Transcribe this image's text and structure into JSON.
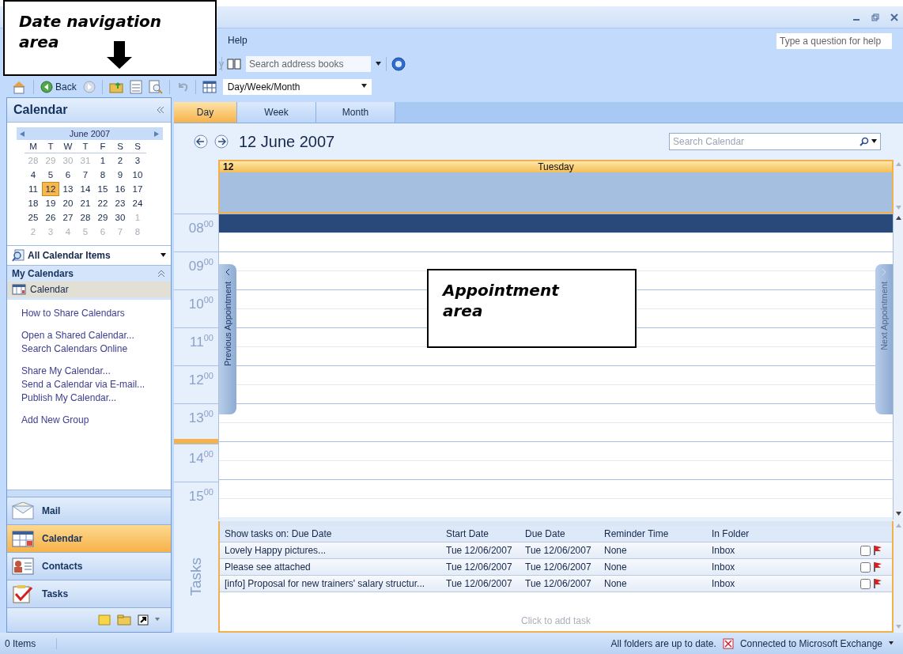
{
  "menu_bar": {
    "items": [
      "Help"
    ],
    "help_box": {
      "placeholder": "Type a question for help"
    }
  },
  "standard_toolbar": {
    "partial_label": "y",
    "address_search": {
      "placeholder": "Search address books"
    }
  },
  "advanced_toolbar": {
    "back": "Back",
    "view_select": {
      "value": "Day/Week/Month"
    }
  },
  "callouts": [
    {
      "kind": "arrow",
      "text": "Date navigation area"
    },
    {
      "kind": "plain",
      "text": "Appointment area"
    }
  ],
  "navigation_pane": {
    "title": "Calendar",
    "mini_calendar": {
      "month": "June 2007",
      "weekdays": [
        "M",
        "T",
        "W",
        "T",
        "F",
        "S",
        "S"
      ],
      "weeks": [
        [
          {
            "day": "28",
            "other_month": true,
            "selected": false
          },
          {
            "day": "29",
            "other_month": true,
            "selected": false
          },
          {
            "day": "30",
            "other_month": true,
            "selected": false
          },
          {
            "day": "31",
            "other_month": true,
            "selected": false
          },
          {
            "day": "1",
            "other_month": false,
            "selected": false
          },
          {
            "day": "2",
            "other_month": false,
            "selected": false
          },
          {
            "day": "3",
            "other_month": false,
            "selected": false
          }
        ],
        [
          {
            "day": "4",
            "other_month": false,
            "selected": false
          },
          {
            "day": "5",
            "other_month": false,
            "selected": false
          },
          {
            "day": "6",
            "other_month": false,
            "selected": false
          },
          {
            "day": "7",
            "other_month": false,
            "selected": false
          },
          {
            "day": "8",
            "other_month": false,
            "selected": false
          },
          {
            "day": "9",
            "other_month": false,
            "selected": false
          },
          {
            "day": "10",
            "other_month": false,
            "selected": false
          }
        ],
        [
          {
            "day": "11",
            "other_month": false,
            "selected": false
          },
          {
            "day": "12",
            "other_month": false,
            "selected": true
          },
          {
            "day": "13",
            "other_month": false,
            "selected": false
          },
          {
            "day": "14",
            "other_month": false,
            "selected": false
          },
          {
            "day": "15",
            "other_month": false,
            "selected": false
          },
          {
            "day": "16",
            "other_month": false,
            "selected": false
          },
          {
            "day": "17",
            "other_month": false,
            "selected": false
          }
        ],
        [
          {
            "day": "18",
            "other_month": false,
            "selected": false
          },
          {
            "day": "19",
            "other_month": false,
            "selected": false
          },
          {
            "day": "20",
            "other_month": false,
            "selected": false
          },
          {
            "day": "21",
            "other_month": false,
            "selected": false
          },
          {
            "day": "22",
            "other_month": false,
            "selected": false
          },
          {
            "day": "23",
            "other_month": false,
            "selected": false
          },
          {
            "day": "24",
            "other_month": false,
            "selected": false
          }
        ],
        [
          {
            "day": "25",
            "other_month": false,
            "selected": false
          },
          {
            "day": "26",
            "other_month": false,
            "selected": false
          },
          {
            "day": "27",
            "other_month": false,
            "selected": false
          },
          {
            "day": "28",
            "other_month": false,
            "selected": false
          },
          {
            "day": "29",
            "other_month": false,
            "selected": false
          },
          {
            "day": "30",
            "other_month": false,
            "selected": false
          },
          {
            "day": "1",
            "other_month": true,
            "selected": false
          }
        ],
        [
          {
            "day": "2",
            "other_month": true,
            "selected": false
          },
          {
            "day": "3",
            "other_month": true,
            "selected": false
          },
          {
            "day": "4",
            "other_month": true,
            "selected": false
          },
          {
            "day": "5",
            "other_month": true,
            "selected": false
          },
          {
            "day": "6",
            "other_month": true,
            "selected": false
          },
          {
            "day": "7",
            "other_month": true,
            "selected": false
          },
          {
            "day": "8",
            "other_month": true,
            "selected": false
          }
        ]
      ]
    },
    "view_filter": "All Calendar Items",
    "my_calendars": {
      "title": "My Calendars",
      "items": [
        {
          "label": "Calendar",
          "selected": true
        }
      ]
    },
    "link_groups": [
      {
        "links": [
          "How to Share Calendars"
        ]
      },
      {
        "links": [
          "Open a Shared Calendar...",
          "Search Calendars Online"
        ]
      },
      {
        "links": [
          "Share My Calendar...",
          "Send a Calendar via E-mail...",
          "Publish My Calendar..."
        ]
      },
      {
        "links": [
          "Add New Group"
        ]
      }
    ],
    "nav_buttons": [
      {
        "kind": "mail",
        "label": "Mail",
        "selected": false
      },
      {
        "kind": "calendar",
        "label": "Calendar",
        "selected": true
      },
      {
        "kind": "contacts",
        "label": "Contacts",
        "selected": false
      },
      {
        "kind": "tasks",
        "label": "Tasks",
        "selected": false
      }
    ]
  },
  "view_tabs": [
    {
      "label": "Day",
      "selected": true
    },
    {
      "label": "Week",
      "selected": false
    },
    {
      "label": "Month",
      "selected": false
    }
  ],
  "date_title": "12 June 2007",
  "search": {
    "placeholder": "Search Calendar"
  },
  "day_header": {
    "number": "12",
    "weekday": "Tuesday"
  },
  "hours": [
    {
      "label": "08$^{00}$",
      "selected": true
    },
    {
      "label": "09$^{00}$",
      "selected": false
    },
    {
      "label": "10$^{00}$",
      "selected": false
    },
    {
      "label": "11$^{00}$",
      "selected": false
    },
    {
      "label": "12$^{00}$",
      "selected": false
    },
    {
      "label": "13$^{00}$",
      "selected": false
    },
    {
      "label": "14$^{00}$",
      "selected": false
    },
    {
      "label": "15$^{00}$",
      "selected": false
    }
  ],
  "side_tabs": {
    "previous": "Previous Appointment",
    "next": "Next Appointment"
  },
  "tasks": {
    "label": "Tasks",
    "columns": [
      "Show tasks on: Due Date",
      "Start Date",
      "Due Date",
      "Reminder Time",
      "In Folder"
    ],
    "rows": [
      {
        "subject": "Lovely Happy pictures...",
        "start": "Tue 12/06/2007",
        "due": "Tue 12/06/2007",
        "reminder": "None",
        "folder": "Inbox",
        "complete": false
      },
      {
        "subject": "Please see attached",
        "start": "Tue 12/06/2007",
        "due": "Tue 12/06/2007",
        "reminder": "None",
        "folder": "Inbox",
        "complete": false
      },
      {
        "subject": "[info] Proposal for new trainers' salary structur...",
        "start": "Tue 12/06/2007",
        "due": "Tue 12/06/2007",
        "reminder": "None",
        "folder": "Inbox",
        "complete": false
      }
    ],
    "add_placeholder": "Click to add task"
  },
  "status_bar": {
    "items": "0 Items",
    "sync": "All folders are up to date.",
    "connection": "Connected to Microsoft Exchange"
  }
}
